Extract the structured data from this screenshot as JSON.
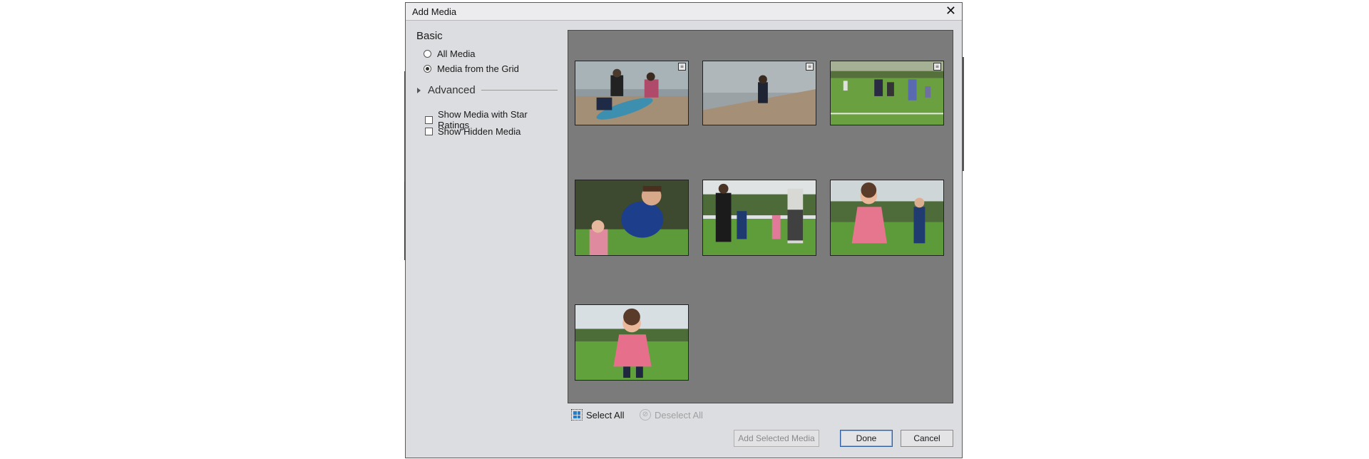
{
  "dialog": {
    "title": "Add Media",
    "close_icon": "close-icon"
  },
  "left": {
    "basic_heading": "Basic",
    "radios": [
      {
        "label": "All Media",
        "checked": false
      },
      {
        "label": "Media from the Grid",
        "checked": true
      }
    ],
    "advanced_label": "Advanced",
    "checkboxes": [
      {
        "label": "Show Media with Star Ratings",
        "checked": false
      },
      {
        "label": "Show Hidden Media",
        "checked": false
      }
    ]
  },
  "grid": {
    "thumbnails": [
      {
        "scene": "family-beach-kayak",
        "stacked": true
      },
      {
        "scene": "child-on-beach",
        "stacked": true
      },
      {
        "scene": "group-on-grass",
        "stacked": true
      },
      {
        "scene": "boy-running-blue-jacket",
        "stacked": false
      },
      {
        "scene": "family-walking-grass",
        "stacked": false
      },
      {
        "scene": "girl-pink-and-boy",
        "stacked": false
      },
      {
        "scene": "girl-pink-running",
        "stacked": false
      }
    ]
  },
  "selection": {
    "select_all": "Select All",
    "deselect_all": "Deselect All"
  },
  "buttons": {
    "add_selected": "Add Selected Media",
    "done": "Done",
    "cancel": "Cancel"
  }
}
